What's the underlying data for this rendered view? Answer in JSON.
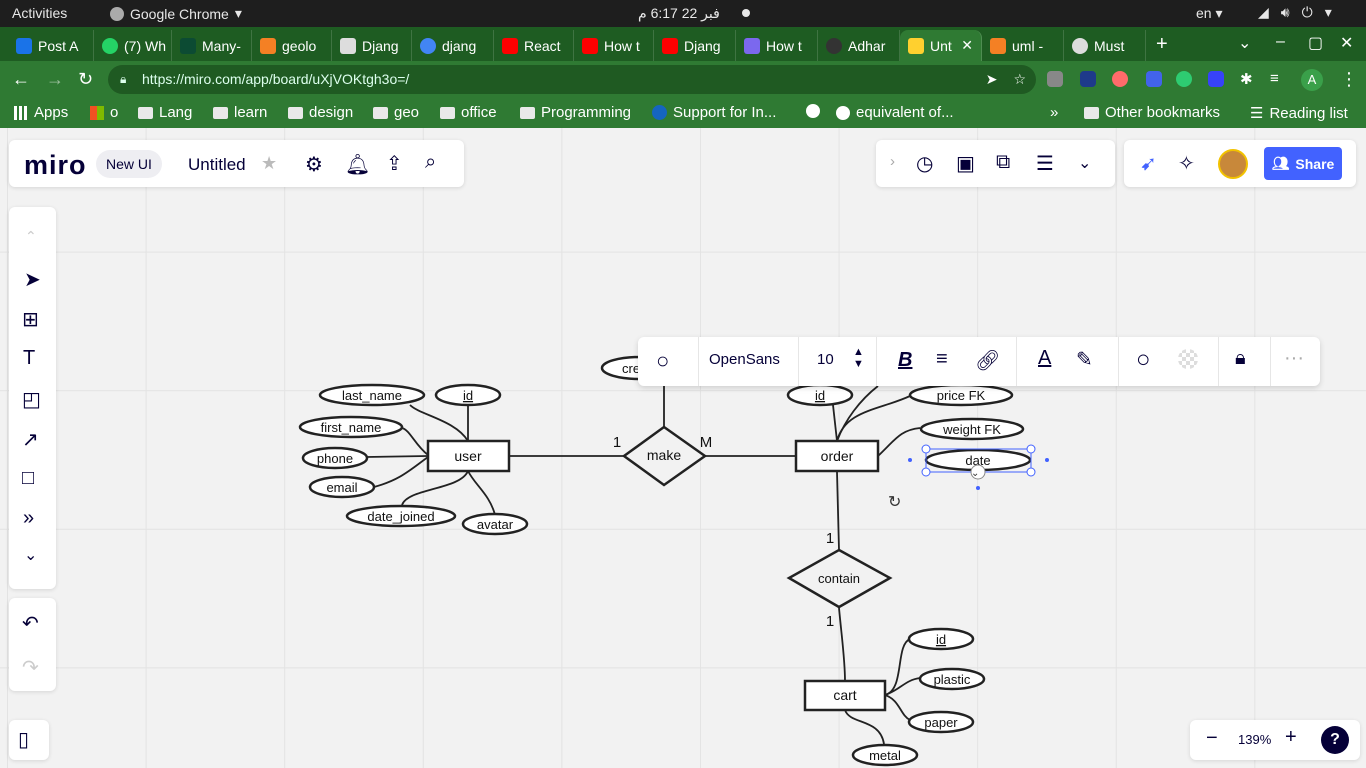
{
  "system_bar": {
    "activities": "Activities",
    "app_name": "Google Chrome",
    "clock": "فبر 22  6:17 م",
    "language": "en"
  },
  "tabs": [
    {
      "label": "Post A",
      "color": "#1a73e8"
    },
    {
      "label": "(7) Wh",
      "color": "#25d366"
    },
    {
      "label": "Many-",
      "color": "#0c4b33"
    },
    {
      "label": "geolo",
      "color": "#f48024"
    },
    {
      "label": "Djang",
      "color": "#dddddd"
    },
    {
      "label": "djang",
      "color": "#4285f4"
    },
    {
      "label": "React",
      "color": "#ff0000"
    },
    {
      "label": "How t",
      "color": "#ff0000"
    },
    {
      "label": "Djang",
      "color": "#ff0000"
    },
    {
      "label": "How t",
      "color": "#7b68ee"
    },
    {
      "label": "Adhar",
      "color": "#333333"
    },
    {
      "label": "Unt",
      "color": "#ffd02f",
      "active": true
    },
    {
      "label": "uml - ",
      "color": "#f48024"
    },
    {
      "label": "Must ",
      "color": "#dddddd"
    }
  ],
  "address_bar": {
    "url": "https://miro.com/app/board/uXjVOKtgh3o=/"
  },
  "bookmarks": {
    "apps": "Apps",
    "items": [
      "o",
      "Lang",
      "learn",
      "design",
      "geo",
      "office",
      "Programming",
      "Support for In...",
      "equivalent of..."
    ],
    "other": "Other bookmarks",
    "reading_list": "Reading list"
  },
  "miro": {
    "logo": "miro",
    "new_ui": "New UI",
    "board_title": "Untitled",
    "share": "Share",
    "zoom": "139%",
    "help": "?"
  },
  "context_toolbar": {
    "font": "OpenSans",
    "font_size": "10"
  },
  "diagram": {
    "entities": {
      "user": "user",
      "order": "order",
      "cart": "cart"
    },
    "relationships": {
      "make": "make",
      "contain": "contain"
    },
    "user_attributes": [
      "last_name",
      "id",
      "first_name",
      "phone",
      "email",
      "date_joined",
      "avatar"
    ],
    "order_attributes": [
      "id",
      "price FK",
      "weight FK",
      "date"
    ],
    "cart_attributes": [
      "id",
      "plastic",
      "paper",
      "metal"
    ],
    "partial_attribute": "cre",
    "cardinalities": {
      "user_make": "1",
      "make_order": "M",
      "order_contain": "1",
      "contain_cart": "1"
    }
  }
}
